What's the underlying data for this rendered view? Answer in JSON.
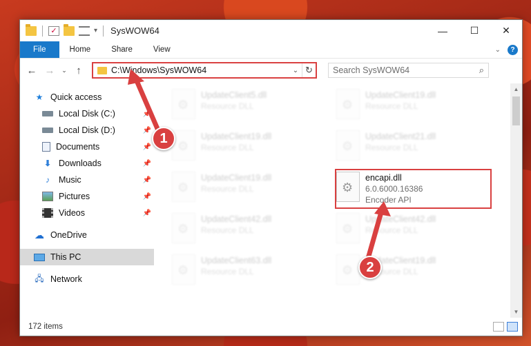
{
  "window": {
    "title": "SysWOW64"
  },
  "ribbon": {
    "tabs": [
      "File",
      "Home",
      "Share",
      "View"
    ],
    "help": "?"
  },
  "nav": {
    "path": "C:\\Windows\\SysWOW64",
    "search_placeholder": "Search SysWOW64"
  },
  "sidebar": {
    "items": [
      {
        "label": "Quick access"
      },
      {
        "label": "Local Disk (C:)"
      },
      {
        "label": "Local Disk (D:)"
      },
      {
        "label": "Documents"
      },
      {
        "label": "Downloads"
      },
      {
        "label": "Music"
      },
      {
        "label": "Pictures"
      },
      {
        "label": "Videos"
      },
      {
        "label": "OneDrive"
      },
      {
        "label": "This PC"
      },
      {
        "label": "Network"
      }
    ]
  },
  "files": [
    {
      "name": "UpdateClient5.dll",
      "desc": "Resource DLL"
    },
    {
      "name": "UpdateClient19.dll",
      "desc": "Resource DLL"
    },
    {
      "name": "UpdateClient19.dll",
      "desc": "Resource DLL"
    },
    {
      "name": "UpdateClient21.dll",
      "desc": "Resource DLL"
    },
    {
      "name": "UpdateClient19.dll",
      "desc": "Resource DLL"
    },
    {
      "name": "encapi.dll",
      "version": "6.0.6000.16386",
      "desc": "Encoder API"
    },
    {
      "name": "UpdateClient42.dll",
      "desc": "Resource DLL"
    },
    {
      "name": "UpdateClient42.dll",
      "desc": "Resource DLL"
    },
    {
      "name": "UpdateClient63.dll",
      "desc": "Resource DLL"
    },
    {
      "name": "UpdateClient19.dll",
      "desc": "Resource DLL"
    }
  ],
  "status": {
    "count": "172 items"
  },
  "annotations": {
    "step1": "1",
    "step2": "2",
    "color": "#d94040"
  }
}
